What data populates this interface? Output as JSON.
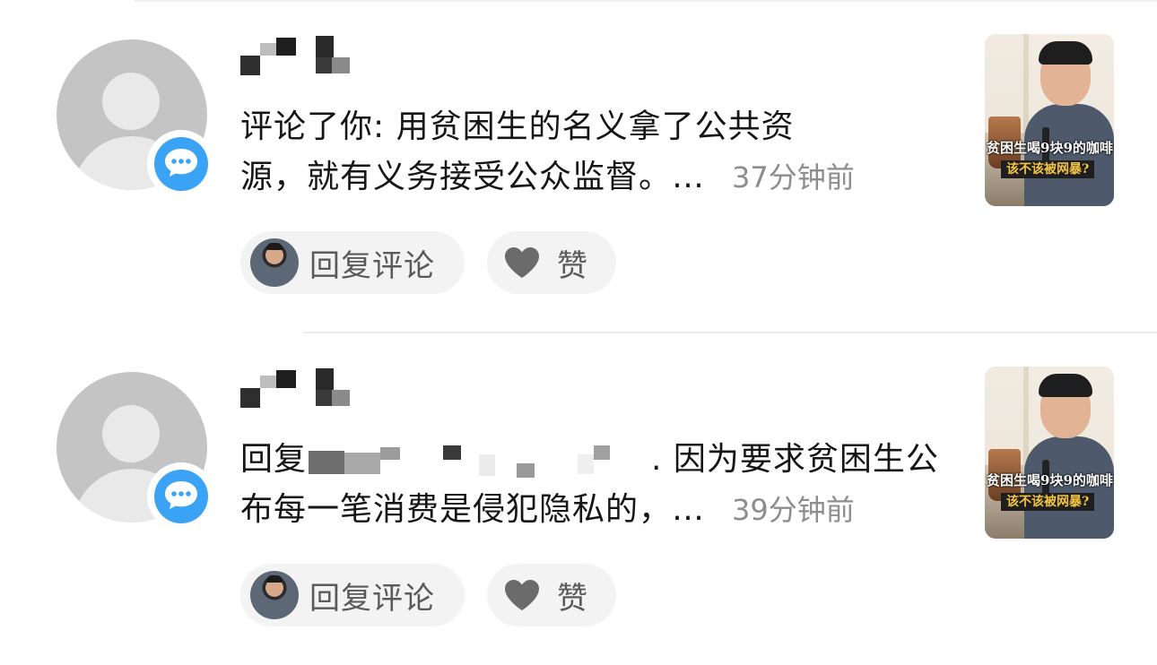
{
  "notifications": [
    {
      "message_line1": "评论了你: 用贫困生的名义拿了公共资",
      "message_line2": "源，就有义务接受公众监督。…",
      "time": "37分钟前",
      "reply_label": "回复评论",
      "like_label": "赞",
      "thumb_caption": "贫困生喝9块9的咖啡",
      "thumb_tag": "该不该被网暴?"
    },
    {
      "message_prefix": "回复",
      "message_line1_suffix": ". 因为要求贫困生公",
      "message_line2": "布每一笔消费是侵犯隐私的，…",
      "time": "39分钟前",
      "reply_label": "回复评论",
      "like_label": "赞",
      "thumb_caption": "贫困生喝9块9的咖啡",
      "thumb_tag": "该不该被网暴?"
    }
  ],
  "icons": {
    "badge": "comment-bubble-icon",
    "like": "heart-icon"
  },
  "colors": {
    "badge_blue": "#3aa3f6",
    "avatar_gray": "#c4c4c4",
    "pill_bg": "#f3f3f3",
    "time_gray": "#8d8d8d"
  }
}
